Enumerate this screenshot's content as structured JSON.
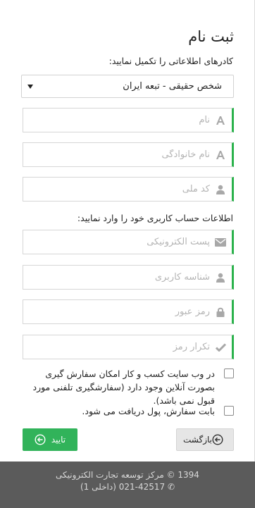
{
  "form": {
    "title": "ثبت نام",
    "section1_label": "کادرهای اطلاعاتی را تکمیل نمایید:",
    "person_type": {
      "selected": "شخص حقیقی - تبعه ایران",
      "options": [
        "شخص حقیقی - تبعه ایران"
      ]
    },
    "first_name": {
      "placeholder": "نام",
      "icon": "letter-a-icon"
    },
    "last_name": {
      "placeholder": "نام خانوادگی",
      "icon": "letter-a-icon"
    },
    "national_code": {
      "placeholder": "کد ملی",
      "icon": "user-icon"
    },
    "section2_label": "اطلاعات حساب کاربری خود را وارد نمایید:",
    "email": {
      "placeholder": "پست الکترونیکی",
      "icon": "envelope-icon"
    },
    "username": {
      "placeholder": "شناسه کاربری",
      "icon": "user-icon"
    },
    "password": {
      "placeholder": "رمز عبور",
      "icon": "lock-icon"
    },
    "password_repeat": {
      "placeholder": "تکرار رمز",
      "icon": "check-icon"
    },
    "check_online_order": "در وب سایت کسب و کار امکان سفارش گیری بصورت آنلاین وجود دارد (سفارشگیری تلفنی مورد قبول نمی باشد).",
    "check_payment": "بابت سفارش، پول دریافت می شود.",
    "confirm_label": "تایید",
    "back_label": "بازگشت"
  },
  "footer": {
    "copyright": "1394 © مرکز توسعه تجارت الکترونیکی",
    "phone": "021-42517 (داخلی 1)",
    "phone_icon": "phone-icon"
  },
  "colors": {
    "accent": "#2bb24c",
    "footer_bg": "#5b5b5b",
    "back_button_bg": "#e6e6e6"
  }
}
